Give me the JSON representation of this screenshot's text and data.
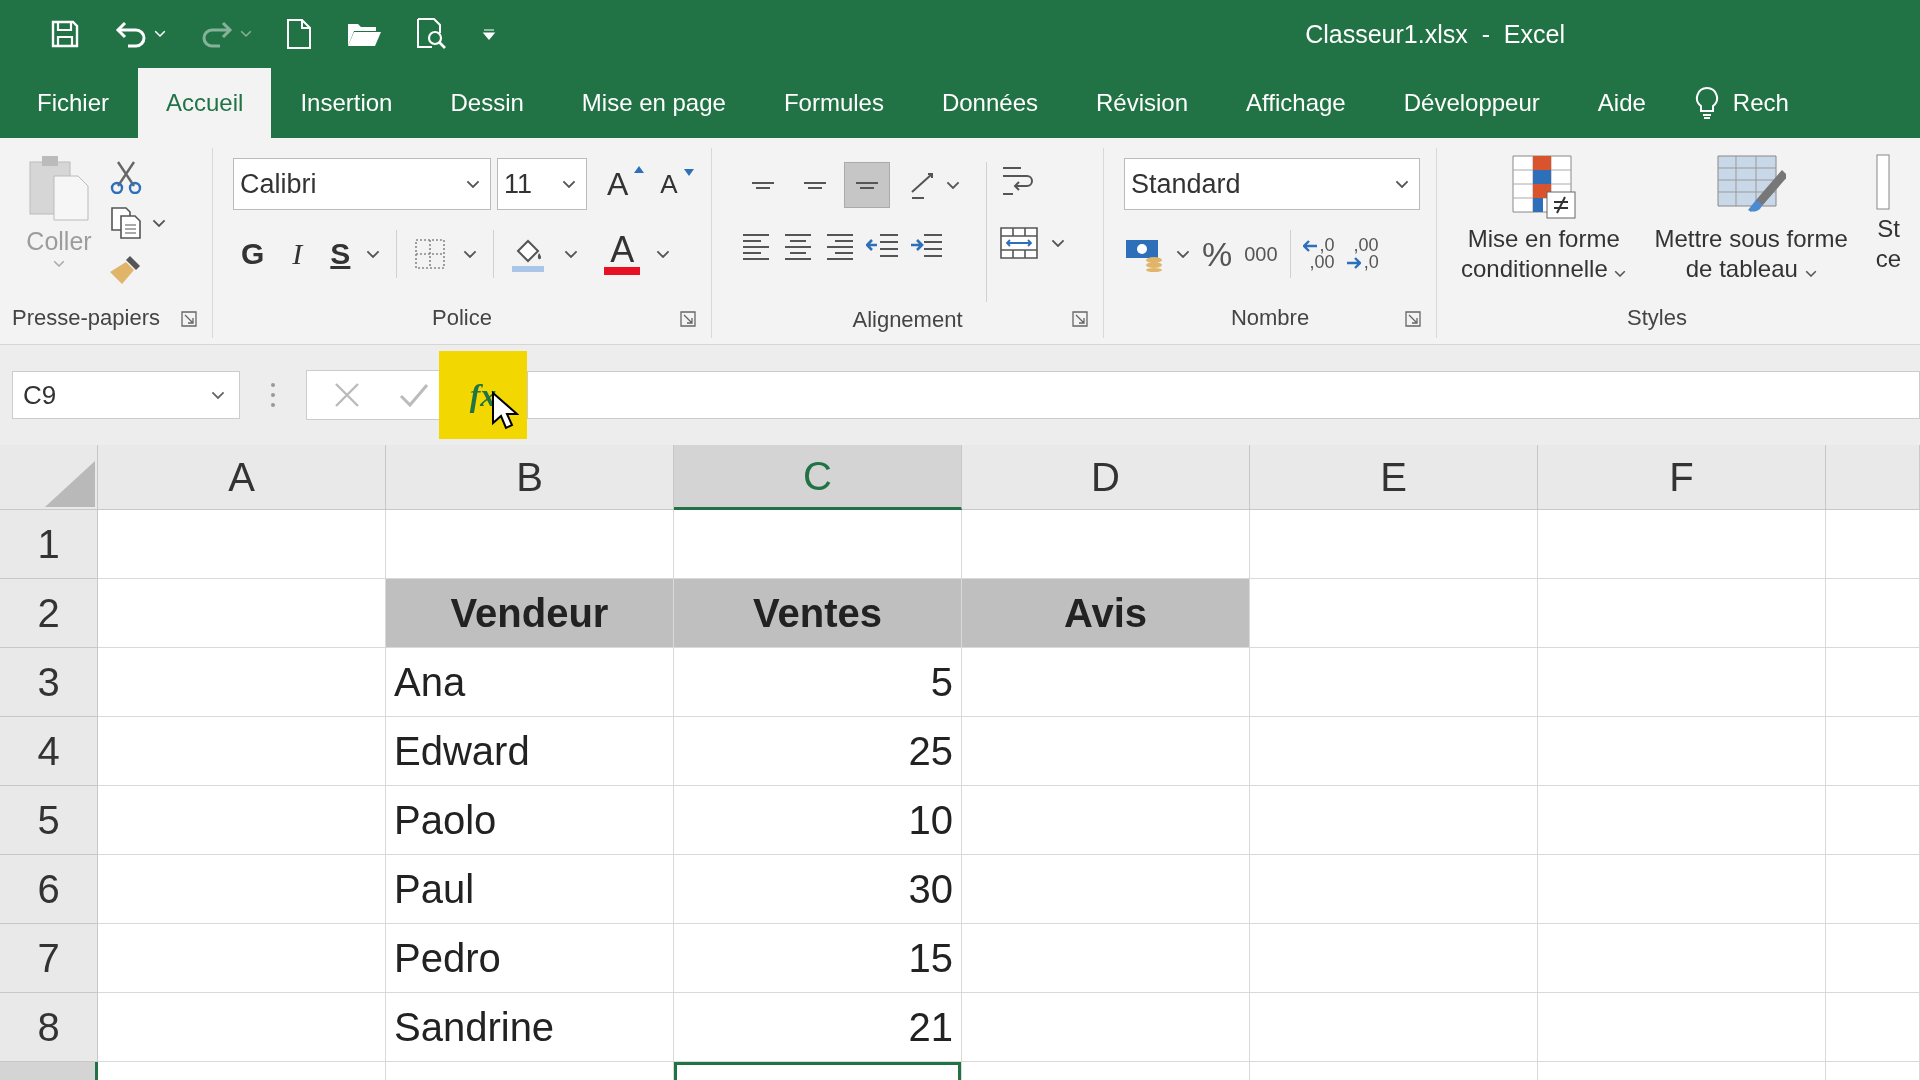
{
  "title_bar": {
    "title": "Classeur1.xlsx  -  Excel"
  },
  "tabs": [
    {
      "label": "Fichier",
      "selected": false
    },
    {
      "label": "Accueil",
      "selected": true
    },
    {
      "label": "Insertion",
      "selected": false
    },
    {
      "label": "Dessin",
      "selected": false
    },
    {
      "label": "Mise en page",
      "selected": false
    },
    {
      "label": "Formules",
      "selected": false
    },
    {
      "label": "Données",
      "selected": false
    },
    {
      "label": "Révision",
      "selected": false
    },
    {
      "label": "Affichage",
      "selected": false
    },
    {
      "label": "Développeur",
      "selected": false
    },
    {
      "label": "Aide",
      "selected": false
    }
  ],
  "tell_me": {
    "label": "Rech"
  },
  "ribbon": {
    "clipboard": {
      "label": "Presse-papiers",
      "paste": "Coller",
      "paste_disabled": true
    },
    "font": {
      "label": "Police",
      "font_name": "Calibri",
      "font_size": "11",
      "grow": "A",
      "shrink": "A",
      "bold": "G",
      "italic": "I",
      "underline": "S",
      "font_color": "A"
    },
    "alignment": {
      "label": "Alignement",
      "vertical": [
        {
          "selected": false
        },
        {
          "selected": false
        },
        {
          "selected": true
        }
      ]
    },
    "number": {
      "label": "Nombre",
      "format": "Standard",
      "percent": "%",
      "thousands": "000",
      "increase_decimal": [
        ",0",
        ",00"
      ],
      "decrease_decimal": [
        ",00",
        ",0"
      ]
    },
    "styles": {
      "label": "Styles",
      "buttons": [
        {
          "kind": "conditional",
          "lines": [
            "Mise en forme",
            "conditionnelle"
          ]
        },
        {
          "kind": "table",
          "lines": [
            "Mettre sous forme",
            "de tableau"
          ]
        },
        {
          "kind": "cell",
          "lines": [
            "St",
            "ce"
          ]
        }
      ]
    }
  },
  "formula_bar": {
    "name_box": "C9",
    "function_label": "fx",
    "highlighted": true
  },
  "sheet": {
    "columns": [
      {
        "label": "A",
        "selected": false
      },
      {
        "label": "B",
        "selected": false
      },
      {
        "label": "C",
        "selected": true
      },
      {
        "label": "D",
        "selected": false
      },
      {
        "label": "E",
        "selected": false
      },
      {
        "label": "F",
        "selected": false
      }
    ],
    "rows": [
      {
        "label": "1",
        "selected": false
      },
      {
        "label": "2",
        "selected": false,
        "kind": "header",
        "cells": {
          "B": {
            "text": "Vendeur"
          },
          "C": {
            "text": "Ventes"
          },
          "D": {
            "text": "Avis"
          }
        }
      },
      {
        "label": "3",
        "selected": false,
        "kind": "data",
        "cells": {
          "B": {
            "text": "Ana",
            "kind": "text"
          },
          "C": {
            "text": "5",
            "kind": "number"
          }
        }
      },
      {
        "label": "4",
        "selected": false,
        "kind": "data",
        "cells": {
          "B": {
            "text": "Edward",
            "kind": "text"
          },
          "C": {
            "text": "25",
            "kind": "number"
          }
        }
      },
      {
        "label": "5",
        "selected": false,
        "kind": "data",
        "cells": {
          "B": {
            "text": "Paolo",
            "kind": "text"
          },
          "C": {
            "text": "10",
            "kind": "number"
          }
        }
      },
      {
        "label": "6",
        "selected": false,
        "kind": "data",
        "cells": {
          "B": {
            "text": "Paul",
            "kind": "text"
          },
          "C": {
            "text": "30",
            "kind": "number"
          }
        }
      },
      {
        "label": "7",
        "selected": false,
        "kind": "data",
        "cells": {
          "B": {
            "text": "Pedro",
            "kind": "text"
          },
          "C": {
            "text": "15",
            "kind": "number"
          }
        }
      },
      {
        "label": "8",
        "selected": false,
        "kind": "data",
        "cells": {
          "B": {
            "text": "Sandrine",
            "kind": "text"
          },
          "C": {
            "text": "21",
            "kind": "number"
          }
        }
      },
      {
        "selected": true
      }
    ]
  }
}
